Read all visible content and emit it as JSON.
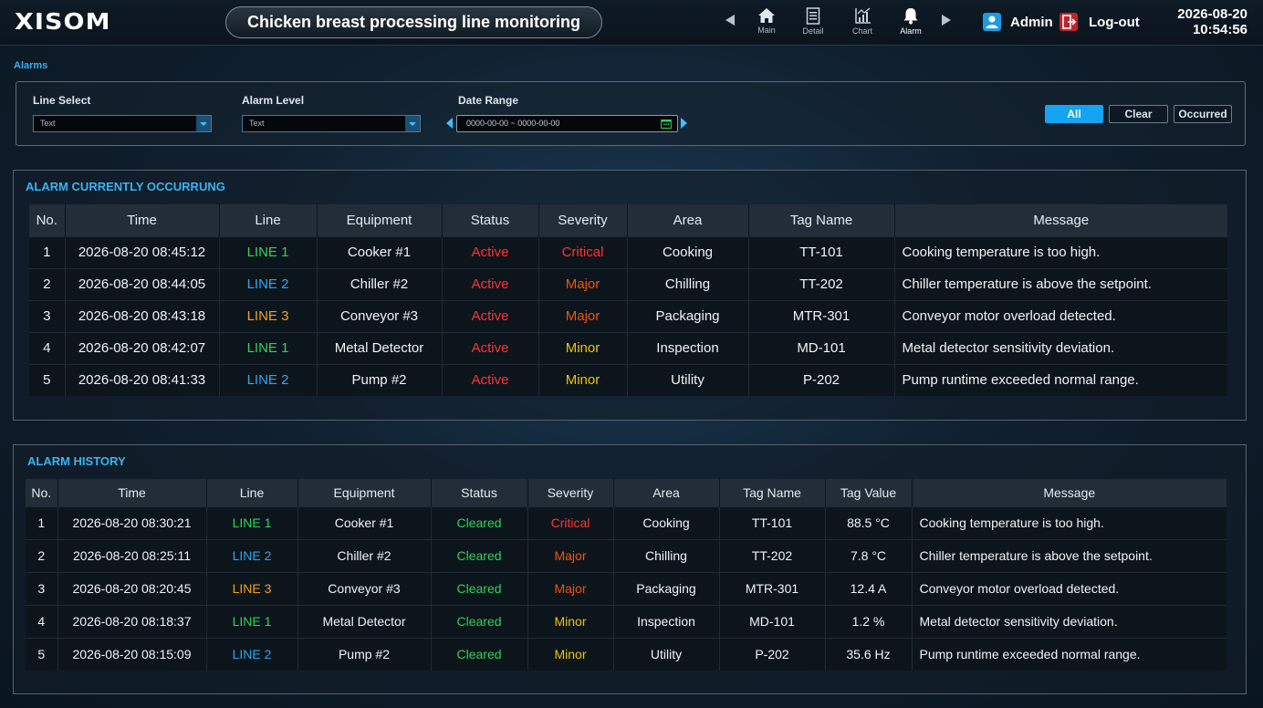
{
  "header": {
    "logo": "XISOM",
    "title": "Chicken breast processing line monitoring",
    "nav": [
      {
        "label": "Main",
        "icon": "home-icon"
      },
      {
        "label": "Detail",
        "icon": "document-icon"
      },
      {
        "label": "Chart",
        "icon": "chart-icon"
      },
      {
        "label": "Alarm",
        "icon": "bell-icon"
      }
    ],
    "user": "Admin",
    "logout": "Log-out",
    "date": "2026-08-20",
    "time": "10:54:56"
  },
  "breadcrumb": "Alarms",
  "filters": {
    "line_label": "Line Select",
    "line_value": "Text",
    "level_label": "Alarm Level",
    "level_value": "Text",
    "date_label": "Date Range",
    "date_value": "0000-00-00 ~ 0000-00-00",
    "buttons": [
      "All",
      "Clear",
      "Occurred"
    ]
  },
  "current": {
    "title": "ALARM CURRENTLY OCCURRUNG",
    "columns": [
      "No.",
      "Time",
      "Line",
      "Equipment",
      "Status",
      "Severity",
      "Area",
      "Tag Name",
      "Message"
    ],
    "rows": [
      [
        "1",
        "2026-08-20 08:45:12",
        "LINE 1",
        "Cooker #1",
        "Active",
        "Critical",
        "Cooking",
        "TT-101",
        "Cooking temperature is too high."
      ],
      [
        "2",
        "2026-08-20 08:44:05",
        "LINE 2",
        "Chiller #2",
        "Active",
        "Major",
        "Chilling",
        "TT-202",
        "Chiller temperature is above the setpoint."
      ],
      [
        "3",
        "2026-08-20 08:43:18",
        "LINE 3",
        "Conveyor #3",
        "Active",
        "Major",
        "Packaging",
        "MTR-301",
        "Conveyor motor overload detected."
      ],
      [
        "4",
        "2026-08-20 08:42:07",
        "LINE 1",
        "Metal Detector",
        "Active",
        "Minor",
        "Inspection",
        "MD-101",
        "Metal detector sensitivity deviation."
      ],
      [
        "5",
        "2026-08-20 08:41:33",
        "LINE 2",
        "Pump #2",
        "Active",
        "Minor",
        "Utility",
        "P-202",
        "Pump runtime exceeded normal range."
      ]
    ]
  },
  "history": {
    "title": "ALARM HISTORY",
    "columns": [
      "No.",
      "Time",
      "Line",
      "Equipment",
      "Status",
      "Severity",
      "Area",
      "Tag Name",
      "Tag Value",
      "Message"
    ],
    "rows": [
      [
        "1",
        "2026-08-20 08:30:21",
        "LINE 1",
        "Cooker #1",
        "Cleared",
        "Critical",
        "Cooking",
        "TT-101",
        "88.5 °C",
        "Cooking temperature is too high."
      ],
      [
        "2",
        "2026-08-20 08:25:11",
        "LINE 2",
        "Chiller #2",
        "Cleared",
        "Major",
        "Chilling",
        "TT-202",
        "7.8 °C",
        "Chiller temperature is above the setpoint."
      ],
      [
        "3",
        "2026-08-20 08:20:45",
        "LINE 3",
        "Conveyor #3",
        "Cleared",
        "Major",
        "Packaging",
        "MTR-301",
        "12.4 A",
        "Conveyor motor overload detected."
      ],
      [
        "4",
        "2026-08-20 08:18:37",
        "LINE 1",
        "Metal Detector",
        "Cleared",
        "Minor",
        "Inspection",
        "MD-101",
        "1.2 %",
        "Metal detector sensitivity deviation."
      ],
      [
        "5",
        "2026-08-20 08:15:09",
        "LINE 2",
        "Pump #2",
        "Cleared",
        "Minor",
        "Utility",
        "P-202",
        "35.6 Hz",
        "Pump runtime exceeded normal range."
      ]
    ]
  },
  "colors": {
    "accent": "#14a4f0",
    "line1": "#2ed45a",
    "line2": "#2aa8f0",
    "line3": "#f0a21a",
    "active": "#ff3434",
    "cleared": "#2ed45a",
    "critical": "#ff3434",
    "major": "#f5520c",
    "minor": "#f2c200"
  }
}
